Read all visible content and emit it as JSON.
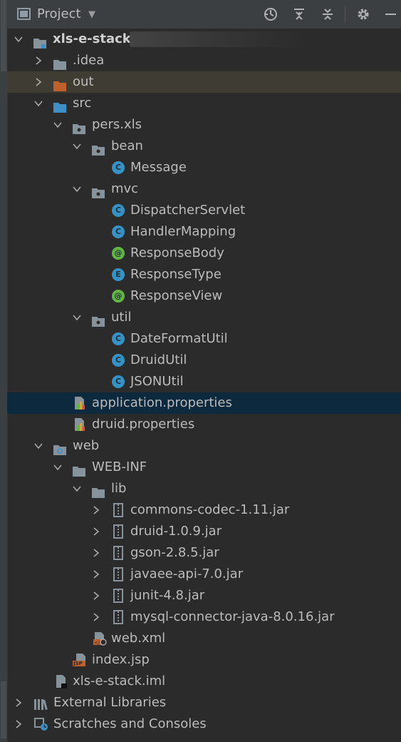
{
  "header": {
    "title": "Project",
    "icons": [
      "globe-icon",
      "collapse-all-icon",
      "expand-all-icon",
      "gear-icon",
      "minimize-icon"
    ]
  },
  "tree": {
    "root": "xls-e-stack",
    "idea": ".idea",
    "out": "out",
    "src": "src",
    "pers_xls": "pers.xls",
    "bean": "bean",
    "message": "Message",
    "mvc": "mvc",
    "dispatcher": "DispatcherServlet",
    "handler": "HandlerMapping",
    "response_body": "ResponseBody",
    "response_type": "ResponseType",
    "response_view": "ResponseView",
    "util": "util",
    "date_format": "DateFormatUtil",
    "druid_util": "DruidUtil",
    "json_util": "JSONUtil",
    "app_props": "application.properties",
    "druid_props": "druid.properties",
    "web": "web",
    "web_inf": "WEB-INF",
    "lib": "lib",
    "jar1": "commons-codec-1.11.jar",
    "jar2": "druid-1.0.9.jar",
    "jar3": "gson-2.8.5.jar",
    "jar4": "javaee-api-7.0.jar",
    "jar5": "junit-4.8.jar",
    "jar6": "mysql-connector-java-8.0.16.jar",
    "web_xml": "web.xml",
    "index_jsp": "index.jsp",
    "iml": "xls-e-stack.iml",
    "ext_libs": "External Libraries",
    "scratches": "Scratches and Consoles"
  },
  "badges": {
    "class": "C",
    "annotation": "@",
    "enum": "E",
    "jsp": "JSP"
  },
  "colors": {
    "background": "#2b2b2b",
    "selected_row": "#0d293e",
    "highlight_row": "#3e3c33",
    "excluded_folder": "#c0602b",
    "source_folder": "#3d8fc6",
    "class_icon": "#3592c4",
    "annotation_icon": "#62b543"
  }
}
